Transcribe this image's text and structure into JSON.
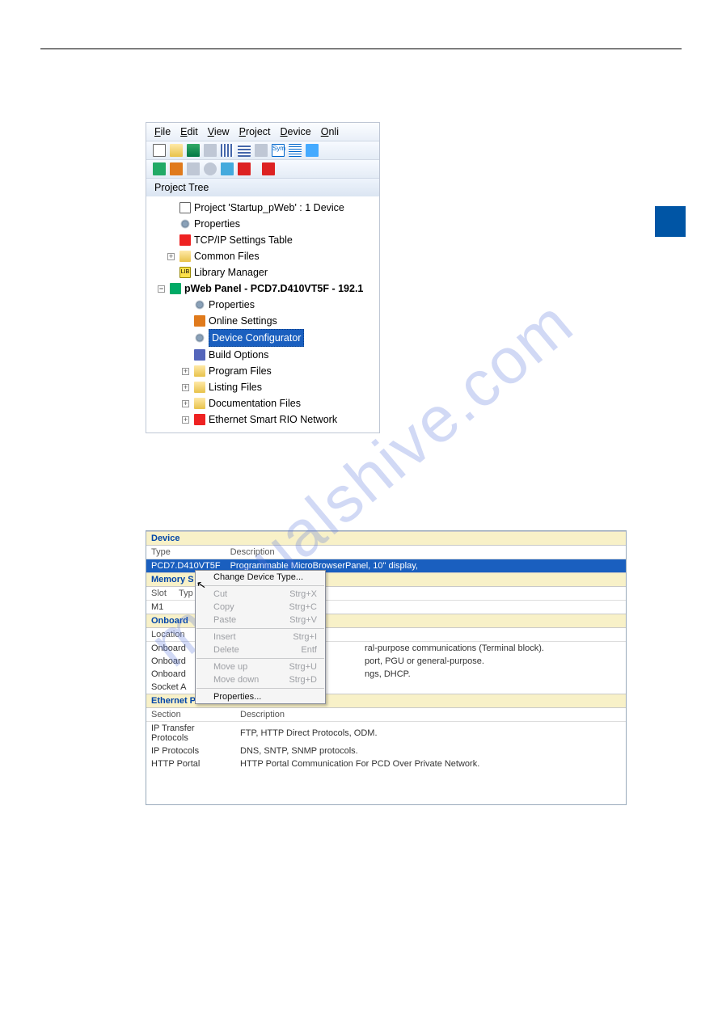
{
  "ide": {
    "menu": {
      "file": "File",
      "edit": "Edit",
      "view": "View",
      "project": "Project",
      "device": "Device",
      "onli": "Onli"
    },
    "panel_title": "Project Tree",
    "tree": {
      "root": "Project 'Startup_pWeb' : 1 Device",
      "props": "Properties",
      "tcpip": "TCP/IP Settings Table",
      "common": "Common Files",
      "libmgr": "Library Manager",
      "device": "pWeb Panel - PCD7.D410VT5F - 192.1",
      "d_props": "Properties",
      "online": "Online Settings",
      "devcfg": "Device Configurator",
      "build": "Build Options",
      "prog": "Program Files",
      "list": "Listing Files",
      "docf": "Documentation Files",
      "eth": "Ethernet Smart RIO Network"
    }
  },
  "ctx": {
    "change": "Change Device Type...",
    "cut": "Cut",
    "cut_sc": "Strg+X",
    "copy": "Copy",
    "copy_sc": "Strg+C",
    "paste": "Paste",
    "paste_sc": "Strg+V",
    "insert": "Insert",
    "insert_sc": "Strg+I",
    "delete": "Delete",
    "delete_sc": "Entf",
    "moveup": "Move up",
    "moveup_sc": "Strg+U",
    "movedn": "Move down",
    "movedn_sc": "Strg+D",
    "props": "Properties..."
  },
  "dev": {
    "sec_device": "Device",
    "th_type": "Type",
    "th_desc": "Description",
    "row_type": "PCD7.D410VT5F",
    "row_desc": "Programmable MicroBrowserPanel, 10\" display,",
    "sec_mem": "Memory S",
    "mem_h1": "Slot",
    "mem_h2": "Typ",
    "mem_r1": "M1",
    "sec_onb": "Onboard",
    "onb_h1": "Location",
    "onb_r1_l": "Onboard",
    "onb_r1_d": "ral-purpose communications (Terminal block).",
    "onb_r2_l": "Onboard",
    "onb_r2_d": "port, PGU or general-purpose.",
    "onb_r3_l": "Onboard",
    "onb_r3_d": "ngs, DHCP.",
    "onb_r4_l": "Socket A",
    "sec_eth": "Ethernet Protocols",
    "eth_h1": "Section",
    "eth_h2": "Description",
    "eth_r1_s": "IP Transfer Protocols",
    "eth_r1_d": "FTP, HTTP Direct Protocols, ODM.",
    "eth_r2_s": "IP Protocols",
    "eth_r2_d": "DNS, SNTP, SNMP protocols.",
    "eth_r3_s": "HTTP Portal",
    "eth_r3_d": "HTTP Portal Communication For PCD Over Private Network."
  },
  "watermark": "manualshive.com"
}
